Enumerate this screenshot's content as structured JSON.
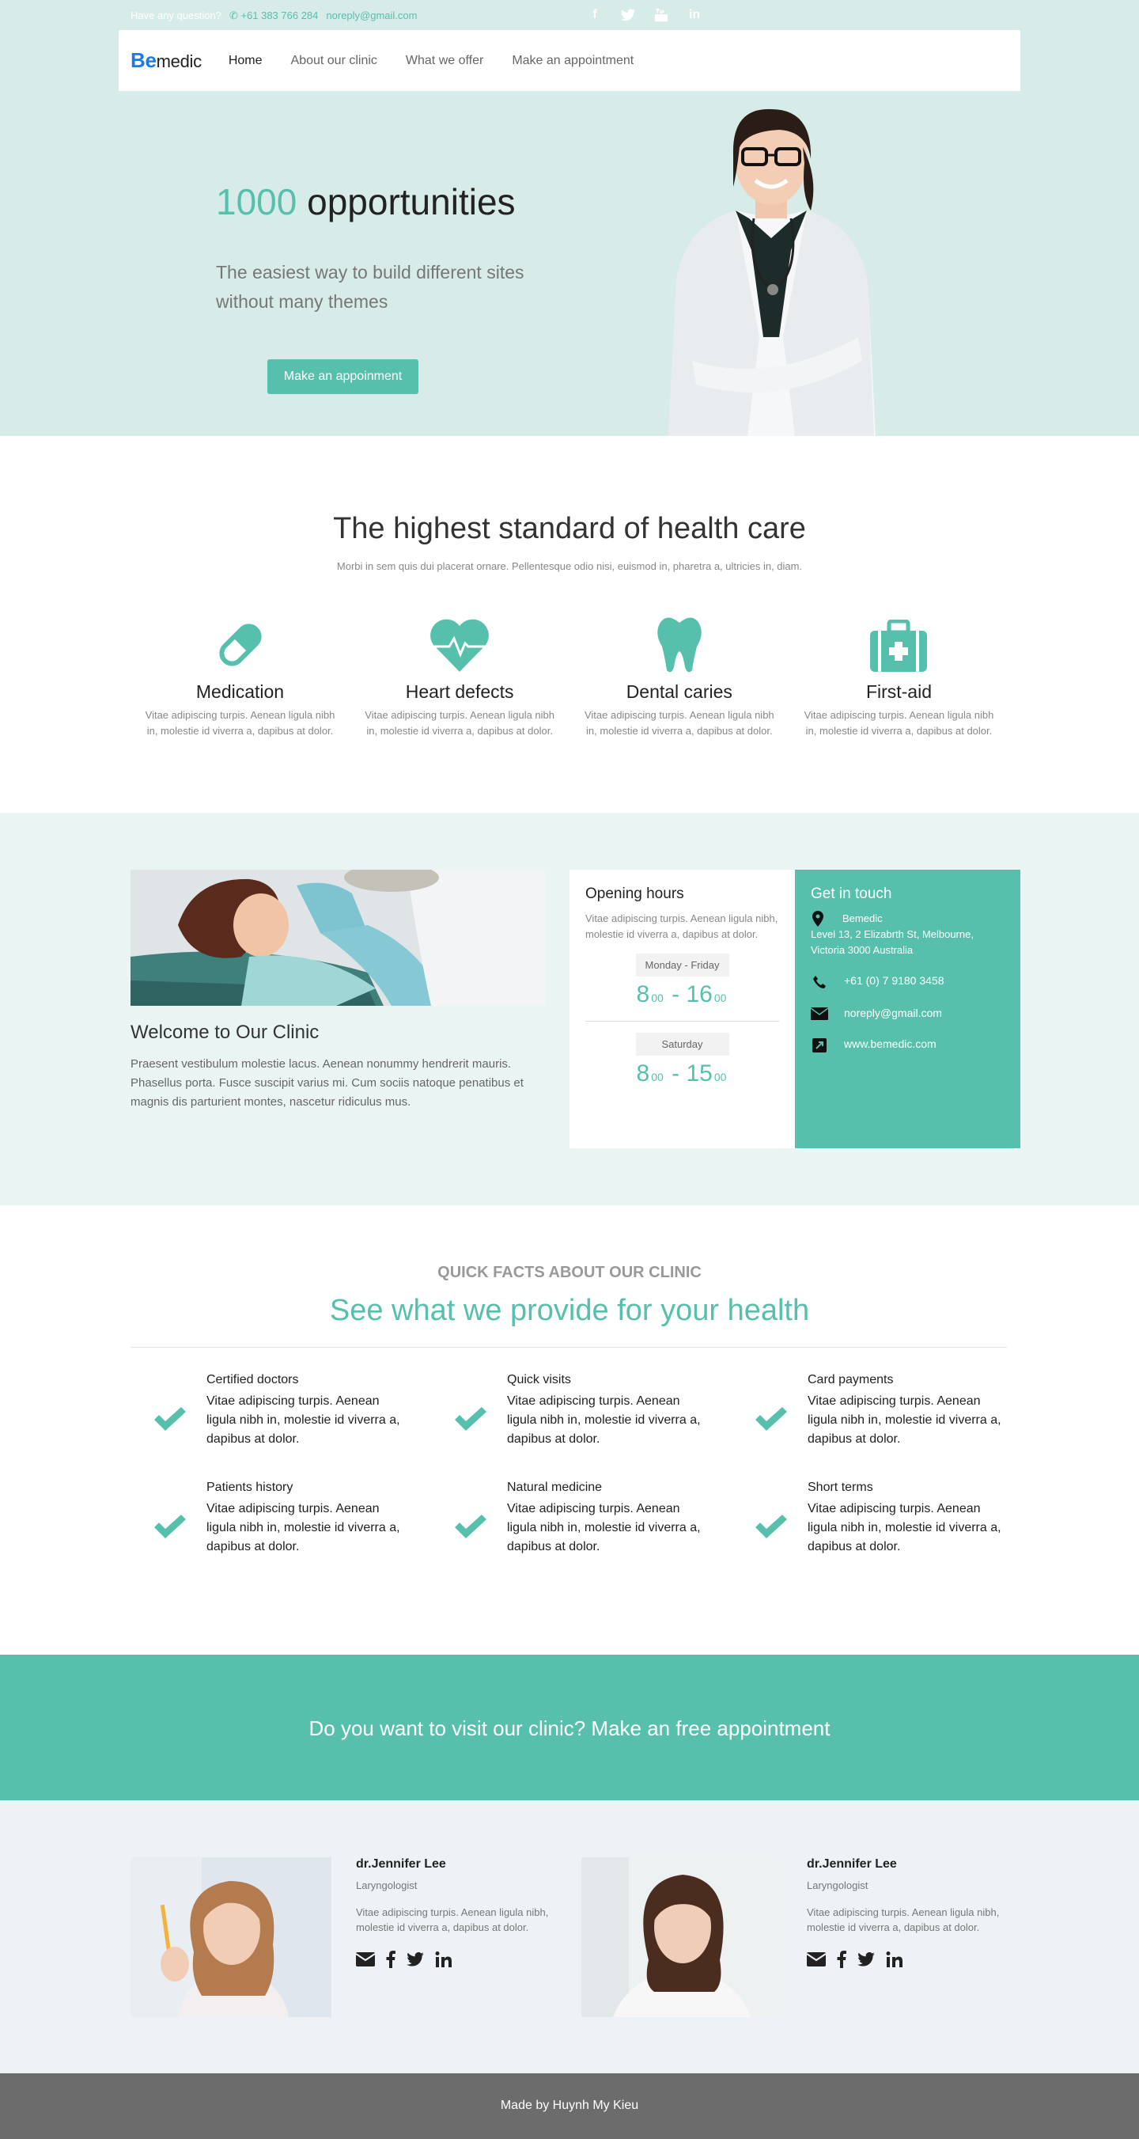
{
  "topbar": {
    "question": "Have any question?",
    "phone": "+61 383 766 284",
    "email": "noreply@gmail.com",
    "social_icons": [
      "facebook-icon",
      "twitter-icon",
      "youtube-icon",
      "linkedin-icon"
    ]
  },
  "nav": {
    "brand_be": "Be",
    "brand_rest": "medic",
    "items": [
      "Home",
      "About our clinic",
      "What we offer",
      "Make an appointment"
    ],
    "active": "Home"
  },
  "hero": {
    "title_accent": "1000",
    "title_rest": "opportunities",
    "subtitle": "The easiest way to build different sites without many themes",
    "button": "Make an appoinment"
  },
  "health": {
    "title": "The highest standard of health care",
    "lead": "Morbi in sem quis dui placerat ornare. Pellentesque odio nisi, euismod in, pharetra a, ultricies in, diam.",
    "features": [
      {
        "icon": "pill-icon",
        "title": "Medication",
        "text": "Vitae adipiscing turpis. Aenean ligula nibh in, molestie id viverra a, dapibus at dolor."
      },
      {
        "icon": "heart-pulse-icon",
        "title": "Heart defects",
        "text": "Vitae adipiscing turpis. Aenean ligula nibh in, molestie id viverra a, dapibus at dolor."
      },
      {
        "icon": "tooth-icon",
        "title": "Dental caries",
        "text": "Vitae adipiscing turpis. Aenean ligula nibh in, molestie id viverra a, dapibus at dolor."
      },
      {
        "icon": "first-aid-kit-icon",
        "title": "First-aid",
        "text": "Vitae adipiscing turpis. Aenean ligula nibh in, molestie id viverra a, dapibus at dolor."
      }
    ]
  },
  "clinic": {
    "welcome_title": "Welcome to Our Clinic",
    "welcome_text": "Praesent vestibulum molestie lacus. Aenean nonummy hendrerit mauris. Phasellus porta. Fusce suscipit varius mi. Cum sociis natoque penatibus et magnis dis parturient montes, nascetur ridiculus mus.",
    "hours": {
      "title": "Opening hours",
      "text": "Vitae adipiscing turpis. Aenean ligula nibh, molestie id viverra a, dapibus at dolor.",
      "weekdays_label": "Monday - Friday",
      "weekdays_open": "8",
      "weekdays_open_min": "00",
      "weekdays_close": "16",
      "weekdays_close_min": "00",
      "saturday_label": "Saturday",
      "saturday_open": "8",
      "saturday_open_min": "00",
      "saturday_close": "15",
      "saturday_close_min": "00",
      "dash": "-"
    },
    "contact": {
      "title": "Get in touch",
      "name": "Bemedic",
      "address": "Level 13, 2 Elizabrth St, Melbourne, Victoria 3000 Australia",
      "phone": "+61 (0) 7 9180 3458",
      "email": "noreply@gmail.com",
      "website": "www.bemedic.com"
    }
  },
  "facts": {
    "kicker": "QUICK FACTS ABOUT OUR CLINIC",
    "headline": "See what we provide for your health",
    "items": [
      {
        "title": "Certified doctors",
        "text": "Vitae adipiscing turpis. Aenean ligula nibh in, molestie id viverra a, dapibus at dolor."
      },
      {
        "title": "Quick visits",
        "text": "Vitae adipiscing turpis. Aenean ligula nibh in, molestie id viverra a, dapibus at dolor."
      },
      {
        "title": "Card payments",
        "text": "Vitae adipiscing turpis. Aenean ligula nibh in, molestie id viverra a, dapibus at dolor."
      },
      {
        "title": "Patients history",
        "text": "Vitae adipiscing turpis. Aenean ligula nibh in, molestie id viverra a, dapibus at dolor."
      },
      {
        "title": "Natural medicine",
        "text": "Vitae adipiscing turpis. Aenean ligula nibh in, molestie id viverra a, dapibus at dolor."
      },
      {
        "title": "Short terms",
        "text": "Vitae adipiscing turpis. Aenean ligula nibh in, molestie id viverra a, dapibus at dolor."
      }
    ]
  },
  "cta": {
    "text": "Do you want to visit our clinic? Make an free appointment"
  },
  "doctors": [
    {
      "name": "dr.Jennifer Lee",
      "role": "Laryngologist",
      "bio": "Vitae adipiscing turpis. Aenean ligula nibh, molestie id viverra a, dapibus at dolor."
    },
    {
      "name": "dr.Jennifer Lee",
      "role": "Laryngologist",
      "bio": "Vitae adipiscing turpis. Aenean ligula nibh, molestie id viverra a, dapibus at dolor."
    }
  ],
  "footer": {
    "text": "Made by Huynh My Kieu"
  },
  "colors": {
    "accent": "#56c0ad",
    "hero_bg": "#d7ebe8",
    "brand_blue": "#1e7ae0",
    "footer_bg": "#6c6c6c"
  }
}
